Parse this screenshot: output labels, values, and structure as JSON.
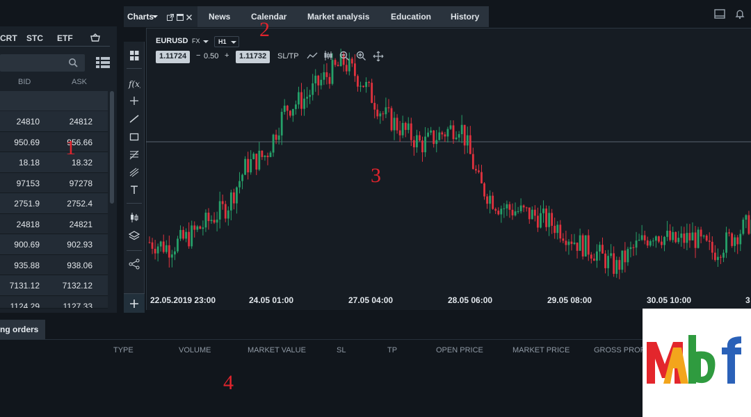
{
  "watchlist": {
    "tabs": [
      "CRT",
      "STC",
      "ETF"
    ],
    "search": {
      "placeholder": ""
    },
    "columns": {
      "bid": "BID",
      "ask": "ASK"
    },
    "rows": [
      {
        "bid": "24810",
        "ask": "24812"
      },
      {
        "bid": "950.69",
        "ask": "956.66"
      },
      {
        "bid": "18.18",
        "ask": "18.32"
      },
      {
        "bid": "97153",
        "ask": "97278"
      },
      {
        "bid": "2751.9",
        "ask": "2752.4"
      },
      {
        "bid": "24818",
        "ask": "24821"
      },
      {
        "bid": "900.69",
        "ask": "902.93"
      },
      {
        "bid": "935.88",
        "ask": "938.06"
      },
      {
        "bid": "7131.12",
        "ask": "7132.12"
      },
      {
        "bid": "1124.29",
        "ask": "1127.33"
      }
    ]
  },
  "topbar": {
    "charts_label": "Charts",
    "tabs": [
      "News",
      "Calendar",
      "Market analysis",
      "Education",
      "History"
    ]
  },
  "chart": {
    "symbol": "EURUSD",
    "market": "FX",
    "timeframe": "H1",
    "bid_price": "1.11724",
    "spread": "0.50",
    "minus": "−",
    "plus": "+",
    "ask_price": "1.11732",
    "sltp": "SL/TP",
    "time_labels": [
      "22.05.2019 23:00",
      "24.05 01:00",
      "27.05 04:00",
      "28.05 06:00",
      "29.05 08:00",
      "30.05 10:00",
      "3"
    ]
  },
  "bottom": {
    "tab_label": "ng orders",
    "columns": [
      "TYPE",
      "VOLUME",
      "MARKET VALUE",
      "SL",
      "TP",
      "OPEN PRICE",
      "MARKET PRICE",
      "GROSS PROFI"
    ]
  },
  "annotations": [
    "1",
    "2",
    "3",
    "4"
  ],
  "colors": {
    "bull": "#26a069",
    "bear": "#e0323e",
    "accent": "#e0242d"
  },
  "chart_data": {
    "type": "candlestick",
    "x": [
      "22.05.2019 23:00",
      "24.05 01:00",
      "27.05 04:00",
      "28.05 06:00",
      "29.05 08:00",
      "30.05 10:00"
    ],
    "close_path": [
      1.1149,
      1.1148,
      1.115,
      1.1153,
      1.1156,
      1.1164,
      1.1166,
      1.1175,
      1.1177,
      1.1181,
      1.1184,
      1.118,
      1.1174,
      1.1171,
      1.1168,
      1.117,
      1.1172,
      1.116,
      1.1156,
      1.1155,
      1.1154,
      1.1152,
      1.1149,
      1.1147,
      1.1144,
      1.1148,
      1.1151,
      1.1149,
      1.115,
      1.1147,
      1.115,
      1.1153
    ]
  }
}
